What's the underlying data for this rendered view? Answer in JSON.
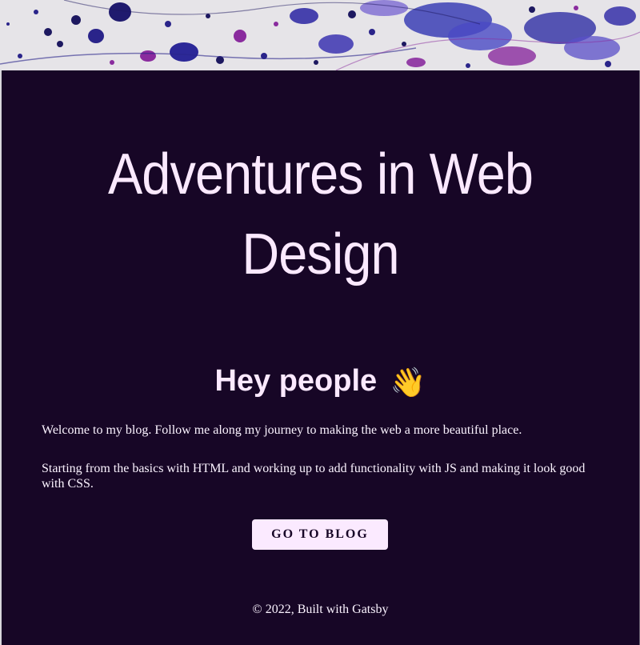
{
  "banner": {
    "image": "paint-splatter-banner"
  },
  "header": {
    "site_title": "Adventures in Web Design"
  },
  "main": {
    "greeting": "Hey people",
    "greeting_icon": "👋",
    "paragraphs": [
      "Welcome to my blog. Follow me along my journey to making the web a more beautiful place.",
      "Starting from the basics with HTML and working up to add functionality with JS and making it look good with CSS."
    ],
    "cta_label": "GO TO BLOG"
  },
  "footer": {
    "text": "© 2022, Built with Gatsby"
  },
  "colors": {
    "background": "#170626",
    "text": "#fbe9ff",
    "button_bg": "#fbeaff",
    "splatter_blue": "#3a2fa8",
    "splatter_purple": "#8a2b9e"
  }
}
